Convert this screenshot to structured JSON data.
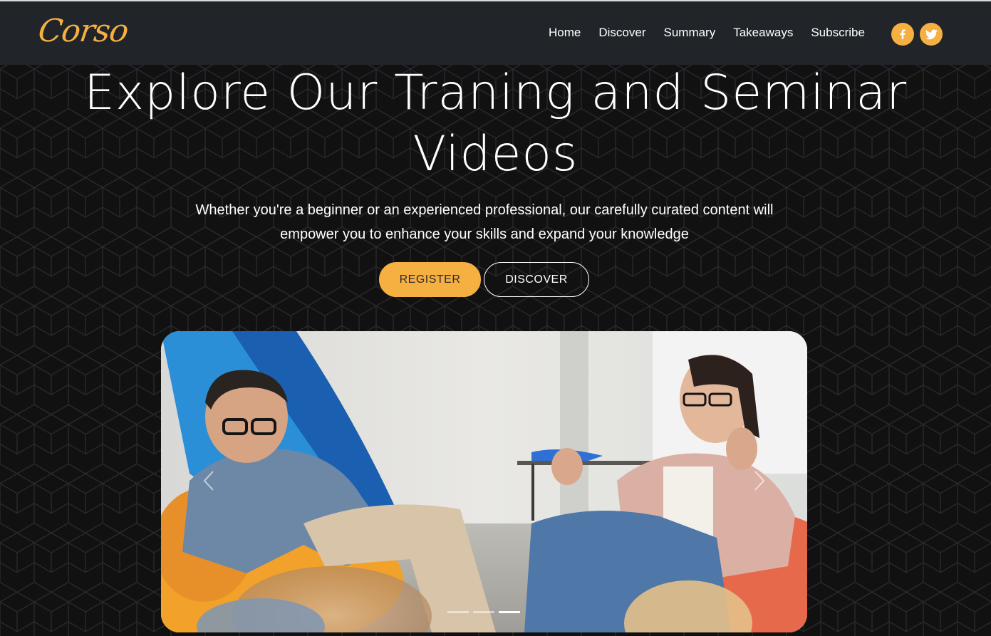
{
  "brand": {
    "logo_text": "Corso",
    "accent_color": "#f5b041",
    "nav_bg": "#212529"
  },
  "nav": {
    "items": [
      {
        "label": "Home"
      },
      {
        "label": "Discover"
      },
      {
        "label": "Summary"
      },
      {
        "label": "Takeaways"
      },
      {
        "label": "Subscribe"
      }
    ],
    "social": [
      {
        "icon": "facebook-icon"
      },
      {
        "icon": "twitter-icon"
      }
    ]
  },
  "hero": {
    "title_line1": "Explore Our Traning and Seminar",
    "title_line2": "Videos",
    "subtitle_line1": "Whether you're a beginner or an experienced professional, our carefully curated content will",
    "subtitle_line2": "empower you to enhance your skills and expand your knowledge",
    "register_label": "REGISTER",
    "discover_label": "DISCOVER"
  },
  "carousel": {
    "slide_count": 3,
    "active_index": 2,
    "prev_icon": "chevron-left-icon",
    "next_icon": "chevron-right-icon"
  }
}
